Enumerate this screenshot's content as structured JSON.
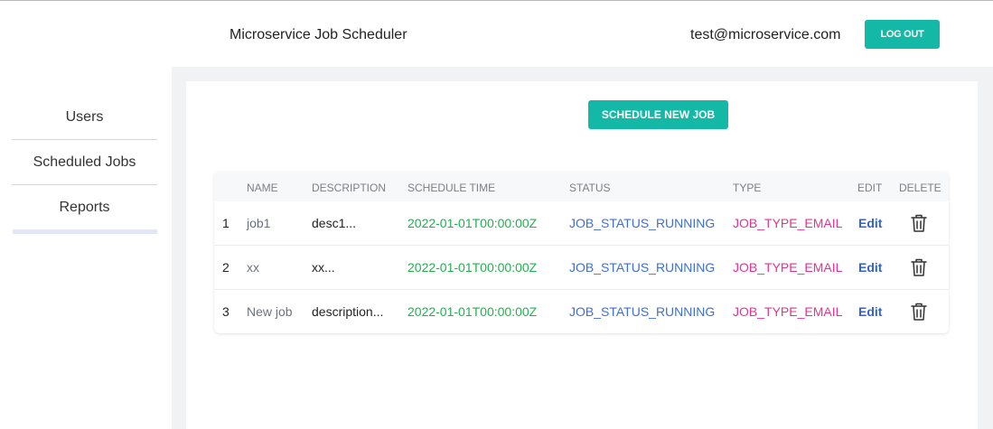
{
  "header": {
    "title": "Microservice Job Scheduler",
    "email": "test@microservice.com",
    "logout_label": "LOG OUT"
  },
  "sidebar": {
    "items": [
      {
        "label": "Users"
      },
      {
        "label": "Scheduled Jobs"
      },
      {
        "label": "Reports"
      }
    ]
  },
  "main": {
    "schedule_button_label": "SCHEDULE NEW JOB",
    "table": {
      "headers": {
        "name": "NAME",
        "description": "DESCRIPTION",
        "schedule_time": "SCHEDULE TIME",
        "status": "STATUS",
        "type": "TYPE",
        "edit": "EDIT",
        "delete": "DELETE"
      },
      "rows": [
        {
          "index": "1",
          "name": "job1",
          "description": "desc1...",
          "schedule_time": "2022-01-01T00:00:00Z",
          "status": "JOB_STATUS_RUNNING",
          "type": "JOB_TYPE_EMAIL",
          "edit": "Edit",
          "delete_icon": "trash-icon"
        },
        {
          "index": "2",
          "name": "xx",
          "description": "xx...",
          "schedule_time": "2022-01-01T00:00:00Z",
          "status": "JOB_STATUS_RUNNING",
          "type": "JOB_TYPE_EMAIL",
          "edit": "Edit",
          "delete_icon": "trash-icon"
        },
        {
          "index": "3",
          "name": "New job",
          "description": "description...",
          "schedule_time": "2022-01-01T00:00:00Z",
          "status": "JOB_STATUS_RUNNING",
          "type": "JOB_TYPE_EMAIL",
          "edit": "Edit",
          "delete_icon": "trash-icon"
        }
      ]
    }
  },
  "colors": {
    "accent": "#14b8a6",
    "time": "#22b04f",
    "status": "#3e6fd8",
    "type": "#e0348f",
    "edit": "#2f62d6"
  }
}
